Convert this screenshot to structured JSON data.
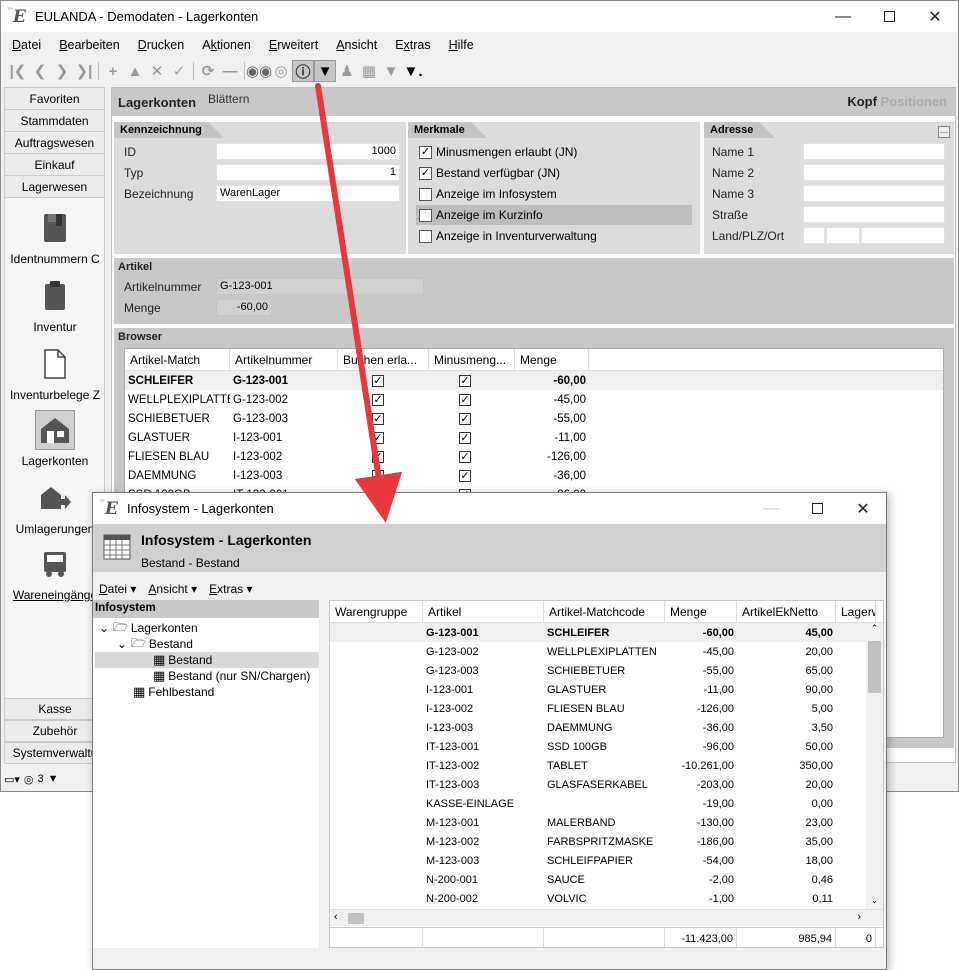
{
  "main_window": {
    "title": "EULANDA - Demodaten - Lagerkonten",
    "menu": [
      {
        "pre": "",
        "u": "D",
        "post": "atei"
      },
      {
        "pre": "",
        "u": "B",
        "post": "earbeiten"
      },
      {
        "pre": "",
        "u": "D",
        "post": "rucken"
      },
      {
        "pre": "A",
        "u": "k",
        "post": "tionen"
      },
      {
        "pre": "",
        "u": "E",
        "post": "rweitert"
      },
      {
        "pre": "",
        "u": "A",
        "post": "nsicht"
      },
      {
        "pre": "E",
        "u": "x",
        "post": "tras"
      },
      {
        "pre": "",
        "u": "H",
        "post": "ilfe"
      }
    ]
  },
  "nav": {
    "top_buttons": [
      "Favoriten",
      "Stammdaten",
      "Auftragswesen",
      "Einkauf",
      "Lagerwesen"
    ],
    "items": [
      {
        "label": "Identnummern C",
        "icon": "book-icon"
      },
      {
        "label": "Inventur",
        "icon": "clipboard-icon"
      },
      {
        "label": "Inventurbelege Z",
        "icon": "document-icon"
      },
      {
        "label": "Lagerkonten",
        "icon": "warehouse-icon"
      },
      {
        "label": "Umlagerungen",
        "icon": "transfer-icon"
      },
      {
        "label": "Wareneingänge",
        "icon": "truck-icon"
      }
    ],
    "bottom_buttons": [
      "Kasse",
      "Zubehör",
      "Systemverwaltu"
    ],
    "status_count": "3"
  },
  "content": {
    "title": "Lagerkonten",
    "subtitle": "Blättern",
    "tab_kopf": "Kopf",
    "tab_positionen": "Positionen",
    "kennzeichnung": {
      "label": "Kennzeichnung",
      "id_label": "ID",
      "id_value": "1000",
      "typ_label": "Typ",
      "typ_value": "1",
      "bez_label": "Bezeichnung",
      "bez_value": "WarenLager"
    },
    "merkmale": {
      "label": "Merkmale",
      "items": [
        {
          "label": "Minusmengen erlaubt (JN)",
          "checked": "✓"
        },
        {
          "label": "Bestand verfügbar (JN)",
          "checked": "✓"
        },
        {
          "label": "Anzeige im Infosystem",
          "checked": ""
        },
        {
          "label": "Anzeige im Kurzinfo",
          "checked": ""
        },
        {
          "label": "Anzeige in Inventurverwaltung",
          "checked": ""
        }
      ]
    },
    "adresse": {
      "label": "Adresse",
      "fields": [
        "Name 1",
        "Name 2",
        "Name 3",
        "Straße",
        "Land/PLZ/Ort"
      ],
      "more_button": "..."
    },
    "artikel": {
      "label": "Artikel",
      "nr_label": "Artikelnummer",
      "nr_value": "G-123-001",
      "menge_label": "Menge",
      "menge_value": "-60,00"
    },
    "browser": {
      "label": "Browser",
      "columns": [
        "Artikel-Match",
        "Artikelnummer",
        "Buchen erla...",
        "Minusmeng...",
        "Menge"
      ],
      "rows": [
        [
          "SCHLEIFER",
          "G-123-001",
          "✓",
          "✓",
          "-60,00"
        ],
        [
          "WELLPLEXIPLATTEN",
          "G-123-002",
          "✓",
          "✓",
          "-45,00"
        ],
        [
          "SCHIEBETUER",
          "G-123-003",
          "✓",
          "✓",
          "-55,00"
        ],
        [
          "GLASTUER",
          "I-123-001",
          "✓",
          "✓",
          "-11,00"
        ],
        [
          "FLIESEN BLAU",
          "I-123-002",
          "✓",
          "✓",
          "-126,00"
        ],
        [
          "DAEMMUNG",
          "I-123-003",
          "✓",
          "✓",
          "-36,00"
        ],
        [
          "SSD 100GB",
          "IT-123-001",
          "✓",
          "✓",
          "-96,00"
        ]
      ]
    }
  },
  "info_window": {
    "title": "Infosystem - Lagerkonten",
    "header_title": "Infosystem - Lagerkonten",
    "header_sub": "Bestand - Bestand",
    "menu": [
      "Datei",
      "Ansicht",
      "Extras"
    ],
    "tree_title": "Infosystem",
    "tree": [
      "Lagerkonten",
      "Bestand",
      "Bestand",
      "Bestand (nur SN/Chargen)",
      "Fehlbestand"
    ],
    "columns": [
      "Warengruppe",
      "Artikel",
      "Artikel-Matchcode",
      "Menge",
      "ArtikelEkNetto",
      "Lagerw"
    ],
    "rows": [
      [
        "",
        "G-123-001",
        "SCHLEIFER",
        "-60,00",
        "45,00"
      ],
      [
        "",
        "G-123-002",
        "WELLPLEXIPLATTEN",
        "-45,00",
        "20,00"
      ],
      [
        "",
        "G-123-003",
        "SCHIEBETUER",
        "-55,00",
        "65,00"
      ],
      [
        "",
        "I-123-001",
        "GLASTUER",
        "-11,00",
        "90,00"
      ],
      [
        "",
        "I-123-002",
        "FLIESEN BLAU",
        "-126,00",
        "5,00"
      ],
      [
        "",
        "I-123-003",
        "DAEMMUNG",
        "-36,00",
        "3,50"
      ],
      [
        "",
        "IT-123-001",
        "SSD 100GB",
        "-96,00",
        "50,00"
      ],
      [
        "",
        "IT-123-002",
        "TABLET",
        "-10.261,00",
        "350,00"
      ],
      [
        "",
        "IT-123-003",
        "GLASFASERKABEL",
        "-203,00",
        "20,00"
      ],
      [
        "",
        "KASSE-EINLAGE",
        "",
        "-19,00",
        "0,00"
      ],
      [
        "",
        "M-123-001",
        "MALERBAND",
        "-130,00",
        "23,00"
      ],
      [
        "",
        "M-123-002",
        "FARBSPRITZMASKE",
        "-186,00",
        "35,00"
      ],
      [
        "",
        "M-123-003",
        "SCHLEIFPAPIER",
        "-54,00",
        "18,00"
      ],
      [
        "",
        "N-200-001",
        "SAUCE",
        "-2,00",
        "0,46"
      ],
      [
        "",
        "N-200-002",
        "VOLVIC",
        "-1,00",
        "0,11"
      ]
    ],
    "footer_menge": "-11.423,00",
    "footer_ek": "985,94",
    "footer_lager": "0"
  },
  "colors": {
    "arrow": "#e8383d",
    "header_gray": "#c8c8c8"
  }
}
